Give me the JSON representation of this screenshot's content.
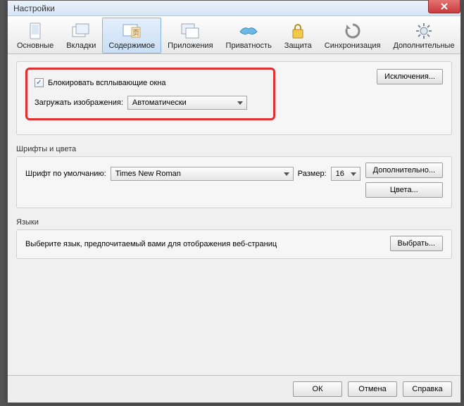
{
  "window": {
    "title": "Настройки"
  },
  "toolbar": {
    "items": [
      {
        "label": "Основные"
      },
      {
        "label": "Вкладки"
      },
      {
        "label": "Содержимое"
      },
      {
        "label": "Приложения"
      },
      {
        "label": "Приватность"
      },
      {
        "label": "Защита"
      },
      {
        "label": "Синхронизация"
      },
      {
        "label": "Дополнительные"
      }
    ],
    "active_index": 2
  },
  "popup_section": {
    "block_popups_label": "Блокировать всплывающие окна",
    "block_popups_checked": true,
    "load_images_label": "Загружать изображения:",
    "load_images_value": "Автоматически",
    "exceptions_button": "Исключения..."
  },
  "fonts_section": {
    "title": "Шрифты и цвета",
    "default_font_label": "Шрифт по умолчанию:",
    "font_value": "Times New Roman",
    "size_label": "Размер:",
    "size_value": "16",
    "advanced_button": "Дополнительно...",
    "colors_button": "Цвета..."
  },
  "lang_section": {
    "title": "Языки",
    "description": "Выберите язык, предпочитаемый вами для отображения веб-страниц",
    "choose_button": "Выбрать..."
  },
  "footer": {
    "ok": "ОК",
    "cancel": "Отмена",
    "help": "Справка"
  }
}
